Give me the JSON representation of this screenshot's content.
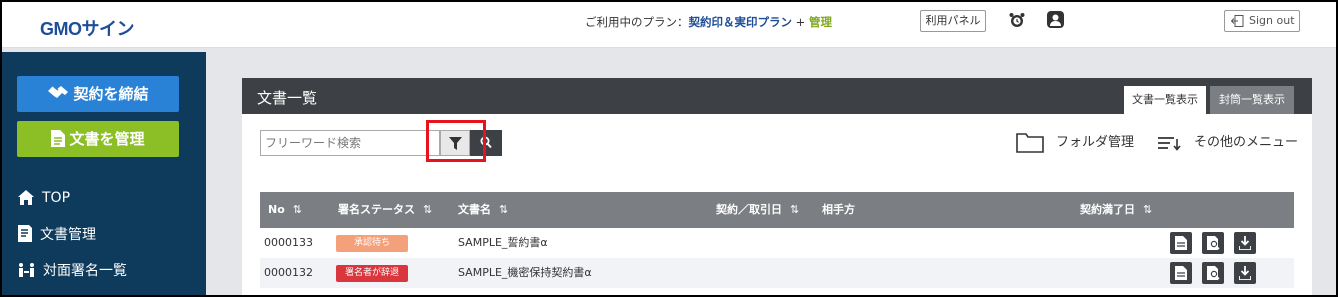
{
  "header": {
    "logo": "GMOサイン",
    "plan_prefix": "ご利用中のプラン：",
    "plan_name": "契約印＆実印プラン",
    "plan_plus": " + ",
    "plan_admin": "管理",
    "panel_button": "利用パネル",
    "signout_button": "Sign out"
  },
  "sidebar": {
    "contract_button": "契約を締結",
    "manage_button": "文書を管理",
    "items": [
      "TOP",
      "文書管理",
      "対面署名一覧"
    ]
  },
  "main": {
    "title": "文書一覧",
    "tabs": [
      "文書一覧表示",
      "封筒一覧表示"
    ],
    "search_placeholder": "フリーワード検索",
    "folder_manage": "フォルダ管理",
    "other_menu": "その他のメニュー",
    "columns": [
      "No",
      "署名ステータス",
      "文書名",
      "契約／取引日",
      "相手方",
      "契約満了日"
    ],
    "sort_glyph": "⇅",
    "rows": [
      {
        "no": "0000133",
        "status": "承認待ち",
        "name": "SAMPLE_誓約書α"
      },
      {
        "no": "0000132",
        "status": "署名者が辞退",
        "name": "SAMPLE_機密保持契約書α"
      }
    ]
  },
  "colors": {
    "sidebar_bg": "#0e3a5b",
    "contract_btn": "#2a82d6",
    "manage_btn": "#8cbf26",
    "status_pending": "#f4a07a",
    "status_declined": "#d9363e",
    "highlight": "#e5141e"
  },
  "icons": [
    "alarm-icon",
    "user-icon",
    "signout-icon",
    "handshake-icon",
    "document-icon",
    "home-icon",
    "docs-icon",
    "face-sign-icon",
    "filter-icon",
    "search-icon",
    "folder-icon",
    "menu-sort-icon",
    "view-icon",
    "preview-icon",
    "download-icon"
  ]
}
